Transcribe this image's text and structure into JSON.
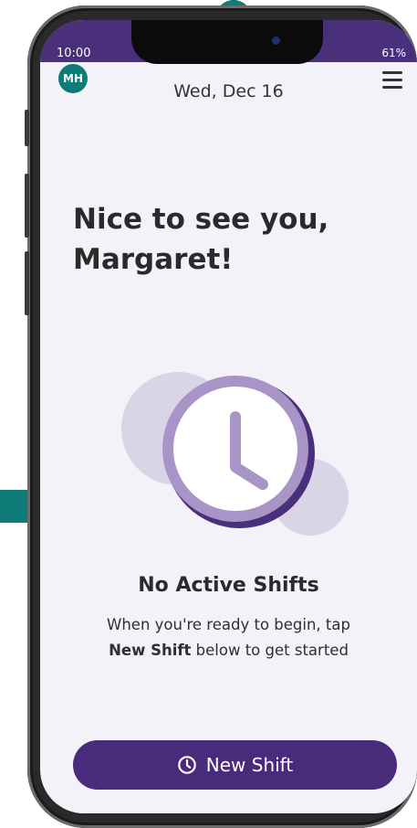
{
  "status_bar": {
    "time": "10:00",
    "battery": "61%"
  },
  "header": {
    "avatar_initials": "MH",
    "date": "Wed, Dec 16"
  },
  "main": {
    "greeting_line1": "Nice to see you,",
    "greeting_line2": "Margaret!",
    "empty_title": "No Active Shifts",
    "empty_message_line1": "When you're ready to begin, tap",
    "empty_message_bold": "New Shift",
    "empty_message_line2": " below to get started"
  },
  "actions": {
    "new_shift_label": "New Shift"
  },
  "colors": {
    "accent": "#4a2a7a",
    "teal": "#0f7b78",
    "illustration": "#a894c6"
  },
  "icons": [
    "menu-icon",
    "clock-icon",
    "clock-illustration"
  ]
}
